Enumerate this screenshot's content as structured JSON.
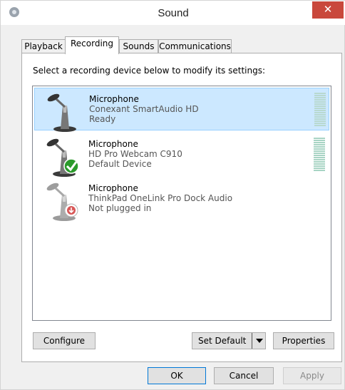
{
  "window": {
    "title": "Sound",
    "close_glyph": "✕"
  },
  "tabs": [
    {
      "label": "Playback",
      "active": false
    },
    {
      "label": "Recording",
      "active": true
    },
    {
      "label": "Sounds",
      "active": false
    },
    {
      "label": "Communications",
      "active": false
    }
  ],
  "instructions": "Select a recording device below to modify its settings:",
  "devices": [
    {
      "name": "Microphone",
      "driver": "Conexant SmartAudio HD",
      "status": "Ready",
      "selected": true,
      "badge": "none",
      "icon": "microphone-icon",
      "level": 0
    },
    {
      "name": "Microphone",
      "driver": "HD Pro Webcam C910",
      "status": "Default Device",
      "selected": false,
      "badge": "green-check",
      "icon": "microphone-icon",
      "level": 0
    },
    {
      "name": "Microphone",
      "driver": "ThinkPad OneLink Pro Dock Audio",
      "status": "Not plugged in",
      "selected": false,
      "badge": "red-down-arrow",
      "icon": "microphone-icon",
      "level": null
    }
  ],
  "buttons": {
    "configure": "Configure",
    "set_default": "Set Default",
    "properties": "Properties",
    "ok": "OK",
    "cancel": "Cancel",
    "apply": "Apply"
  },
  "colors": {
    "selection_bg": "#cce8ff",
    "selection_border": "#99d1ff",
    "close_bg": "#c9483c",
    "ok_border": "#0078d7"
  }
}
